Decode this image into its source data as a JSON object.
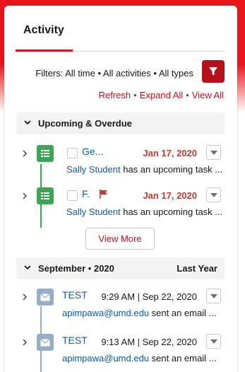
{
  "tabs": [
    {
      "label": "Activity"
    }
  ],
  "filters": {
    "text": "Filters: All time • All activities • All types"
  },
  "links": {
    "refresh": "Refresh",
    "expand_all": "Expand All",
    "view_all": "View All",
    "separator": "•"
  },
  "sections": [
    {
      "title": "Upcoming & Overdue",
      "right": "",
      "items": [
        {
          "type": "task",
          "subject": "Ge...",
          "date": "Jan 17, 2020",
          "who": "Sally Student",
          "text": " has an upcoming task ...",
          "flagged": false,
          "overdue": true
        },
        {
          "type": "task",
          "subject": "F.",
          "date": "Jan 17, 2020",
          "who": "Sally Student",
          "text": " has an upcoming task ...",
          "flagged": true,
          "overdue": true
        }
      ],
      "view_more": "View More"
    },
    {
      "title": "September • 2020",
      "right": "Last Year",
      "items": [
        {
          "type": "email",
          "subject": "TEST",
          "date": "9:29 AM | Sep 22, 2020",
          "who": "apimpawa@umd.edu",
          "text": " sent an email ..."
        },
        {
          "type": "email",
          "subject": "TEST",
          "date": "9:13 AM | Sep 22, 2020",
          "who": "apimpawa@umd.edu",
          "text": " sent an email ..."
        }
      ]
    }
  ],
  "colors": {
    "brand_red": "#e8151b",
    "task_green": "#3ba755",
    "email_blue": "#95aec5",
    "link_blue": "#0b5cab",
    "overdue_red": "#c23934"
  }
}
